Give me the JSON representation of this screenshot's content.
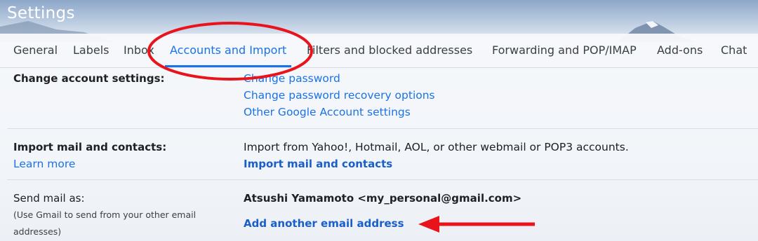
{
  "header": {
    "title": "Settings"
  },
  "tabs": [
    {
      "label": "General"
    },
    {
      "label": "Labels"
    },
    {
      "label": "Inbox"
    },
    {
      "label": "Accounts and Import",
      "active": true
    },
    {
      "label": "Filters and blocked addresses"
    },
    {
      "label": "Forwarding and POP/IMAP"
    },
    {
      "label": "Add-ons"
    },
    {
      "label": "Chat"
    }
  ],
  "sections": {
    "change_account": {
      "label": "Change account settings:",
      "links": [
        "Change password",
        "Change password recovery options",
        "Other Google Account settings"
      ]
    },
    "import": {
      "label": "Import mail and contacts:",
      "learn_more": "Learn more",
      "description": "Import from Yahoo!, Hotmail, AOL, or other webmail or POP3 accounts.",
      "action": "Import mail and contacts"
    },
    "send_as": {
      "label": "Send mail as:",
      "note": "(Use Gmail to send from your other email addresses)",
      "identity": "Atsushi Yamamoto <my_personal@gmail.com>",
      "action": "Add another email address"
    }
  },
  "annotations": {
    "highlight_color": "#e8131b"
  }
}
